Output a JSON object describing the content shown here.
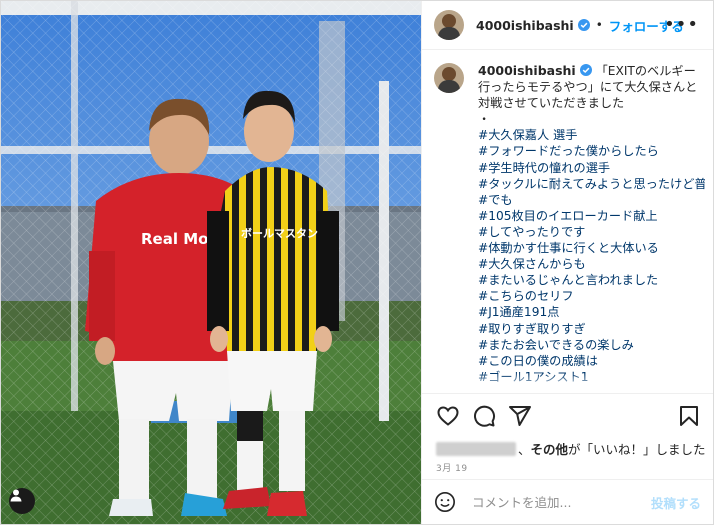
{
  "header": {
    "username": "4000ishibashi",
    "separator": "•",
    "follow_label": "フォローする",
    "more_label": "•••"
  },
  "caption": {
    "username": "4000ishibashi",
    "intro": "「EXITのベルギー行ったらモテるやつ」にて大久保さんと対戦させていただきました",
    "bullet": "・",
    "lines": [
      "#大久保嘉人 選手",
      "#フォワードだった僕からしたら",
      "#学生時代の憧れの選手",
      "#タックルに耐えてみようと思ったけど普通に飛ばされました",
      "#でも",
      "#105枚目のイエローカード献上",
      "#してやったりです",
      "#体動かす仕事に行くと大体いる",
      "#大久保さんからも",
      "#またいるじゃんと言われました",
      "#こちらのセリフ",
      "#J1通産191点",
      "#取りすぎ取りすぎ",
      "#またお会いできるの楽しみ",
      "#この日の僕の成績は",
      "#ゴール1アシスト1"
    ]
  },
  "photo": {
    "shirt_left_text": "Real Moterd",
    "shirt_right_text": "ボールマスタン"
  },
  "actions": {
    "icons": [
      "heart-icon",
      "comment-icon",
      "share-icon",
      "bookmark-icon"
    ]
  },
  "likes": {
    "text": "、その他が「いいね！」しました",
    "others_bold": "その他"
  },
  "date": "3月 19",
  "add_comment": {
    "placeholder": "コメントを追加...",
    "post_label": "投稿する"
  },
  "colors": {
    "follow_blue": "#0095f6",
    "hashtag_blue": "#00376b",
    "verified_blue": "#3897f0",
    "post_disabled": "#b2dffc"
  }
}
